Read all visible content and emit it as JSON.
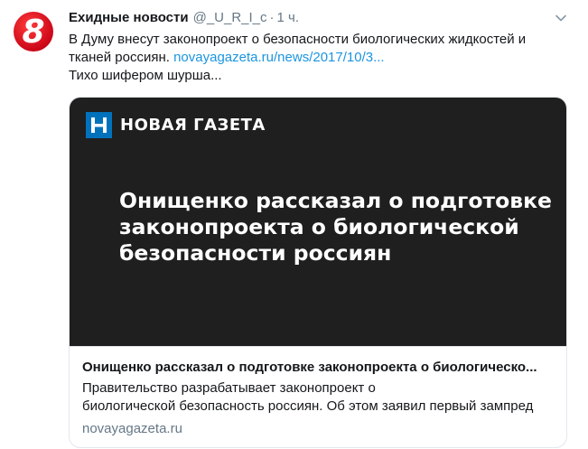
{
  "tweet": {
    "author_name": "Ехидные новости",
    "handle": "@_U_R_I_c",
    "separator": "·",
    "time": "1 ч.",
    "text": {
      "line1": "В Думу внесут законопроект о безопасности биологических жидкостей и",
      "line2_prefix": "тканей россиян.",
      "link": "novayagazeta.ru/news/2017/10/3...",
      "line3": "Тихо шифером шурша..."
    },
    "avatar": {
      "glyph": "8",
      "icon": "channel-8-logo"
    }
  },
  "card": {
    "brand": "НОВАЯ ГАЗЕТА",
    "brand_logo_glyph": "Н",
    "headline": {
      "line1": "Онищенко рассказал о подготовке",
      "line2": "законопроекта о биологической",
      "line3": "безопасности россиян"
    },
    "title": "Онищенко рассказал о подготовке законопроекта о биологическо...",
    "description": {
      "line1": "Правительство разрабатывает законопроект о",
      "line2": "биологической безопасность россиян. Об этом заявил первый зампред"
    },
    "domain": "novayagazeta.ru"
  },
  "colors": {
    "link": "#1b95e0",
    "secondary_text": "#657786",
    "card_image_bg": "#1f1f1f",
    "avatar_red": "#e3001b",
    "brand_blue": "#0072bc"
  }
}
